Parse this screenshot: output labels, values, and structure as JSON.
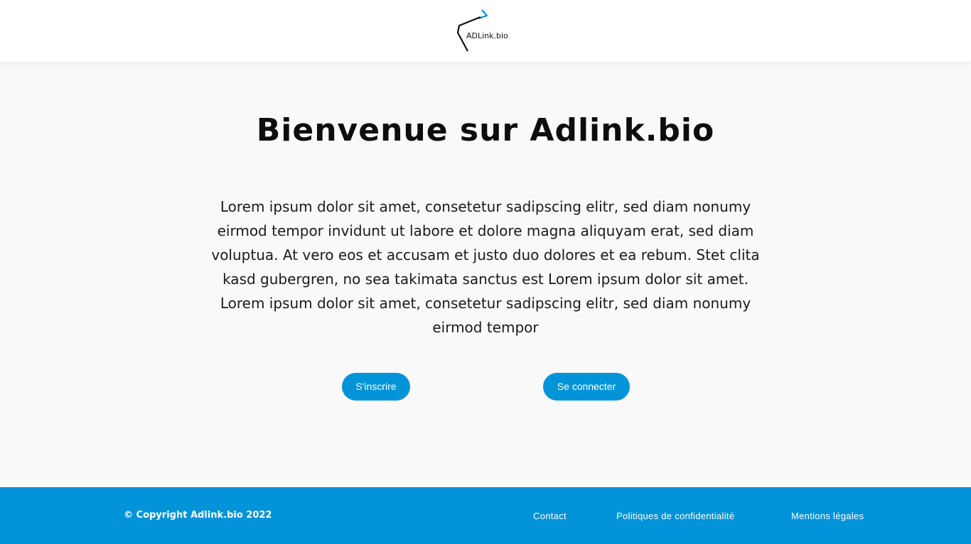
{
  "header": {
    "logo_text": "ADLink.bio"
  },
  "main": {
    "title": "Bienvenue sur Adlink.bio",
    "paragraph": "Lorem ipsum dolor sit amet, consetetur sadipscing elitr, sed diam nonumy eirmod tempor invidunt ut labore et dolore magna aliquyam erat, sed diam voluptua. At vero eos et accusam et justo duo dolores et ea rebum. Stet clita kasd gubergren, no sea takimata sanctus est Lorem ipsum dolor sit amet. Lorem ipsum dolor sit amet, consetetur sadipscing elitr, sed diam nonumy eirmod tempor",
    "signup_label": "S'inscrire",
    "login_label": "Se connecter"
  },
  "footer": {
    "copyright": "© Copyright Adlink.bio 2022",
    "links": [
      {
        "label": "Contact"
      },
      {
        "label": "Politiques de confidentialité"
      },
      {
        "label": "Mentions légales"
      }
    ]
  },
  "colors": {
    "accent": "#0393d8",
    "background": "#f9f9f9",
    "header": "#ffffff"
  }
}
